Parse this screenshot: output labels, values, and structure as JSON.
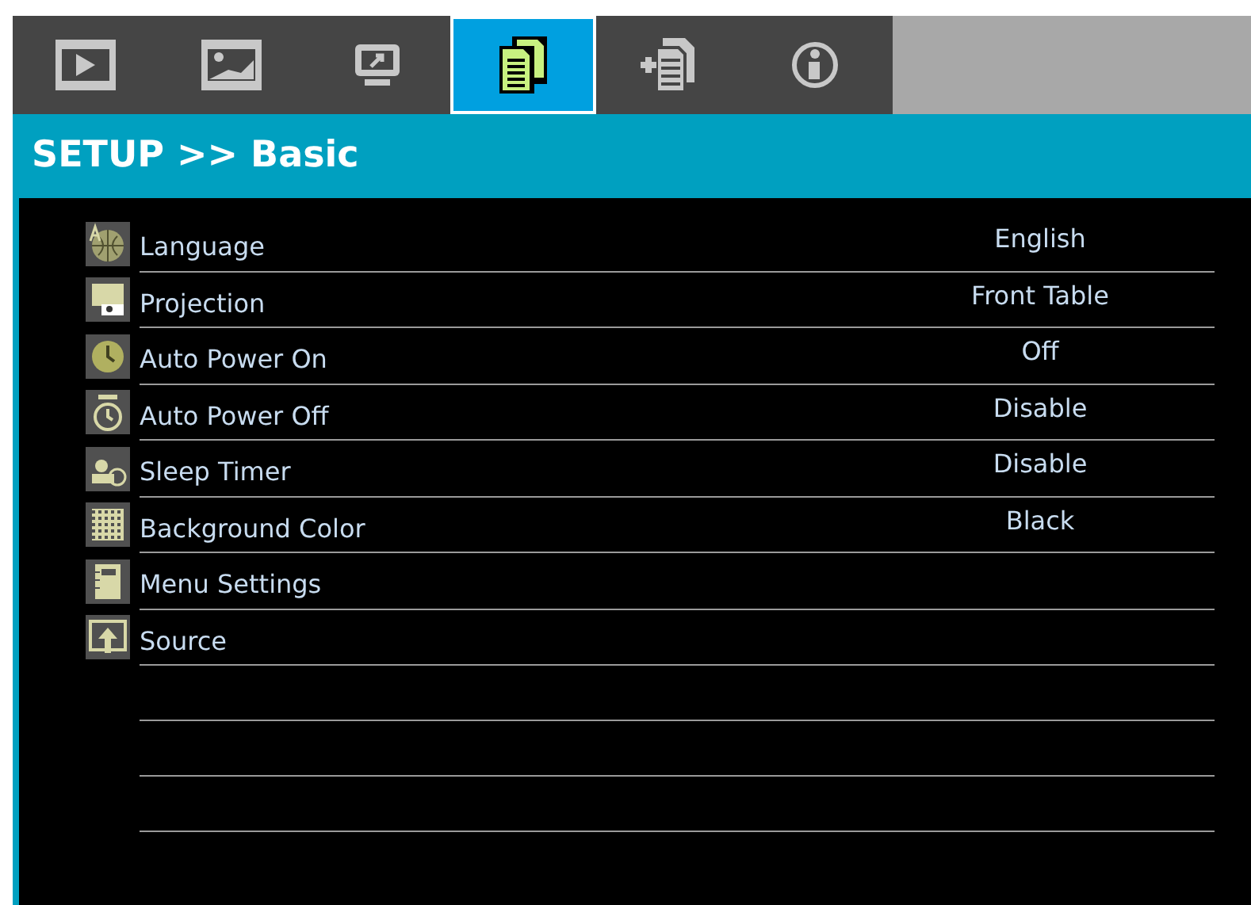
{
  "tabs": [
    {
      "selected": false
    },
    {
      "selected": false
    },
    {
      "selected": false
    },
    {
      "selected": true
    },
    {
      "selected": false
    },
    {
      "selected": false
    }
  ],
  "header": {
    "title": "SETUP >> Basic"
  },
  "items": [
    {
      "label": "Language",
      "value": "English"
    },
    {
      "label": "Projection",
      "value": "Front Table"
    },
    {
      "label": "Auto Power On",
      "value": "Off"
    },
    {
      "label": "Auto Power Off",
      "value": "Disable"
    },
    {
      "label": "Sleep Timer",
      "value": "Disable"
    },
    {
      "label": "Background Color",
      "value": "Black"
    },
    {
      "label": "Menu Settings"
    },
    {
      "label": "Source"
    }
  ]
}
